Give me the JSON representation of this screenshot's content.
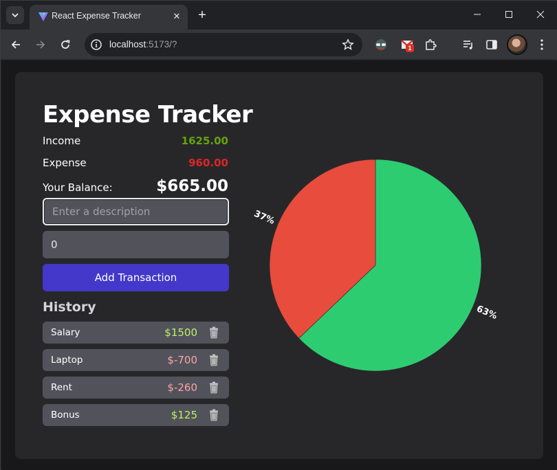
{
  "browser": {
    "tab_title": "React Expense Tracker",
    "url_host": "localhost",
    "url_rest": ":5173/?",
    "extension_badge": "1"
  },
  "app": {
    "title": "Expense Tracker",
    "income_label": "Income",
    "income_value": "1625.00",
    "expense_label": "Expense",
    "expense_value": "960.00",
    "balance_label": "Your Balance:",
    "balance_value": "$665.00",
    "description_placeholder": "Enter a description",
    "amount_value": "0",
    "add_button": "Add Transaction",
    "history_title": "History",
    "history": [
      {
        "desc": "Salary",
        "amount": "$1500",
        "type": "pos"
      },
      {
        "desc": "Laptop",
        "amount": "$-700",
        "type": "neg"
      },
      {
        "desc": "Rent",
        "amount": "$-260",
        "type": "neg"
      },
      {
        "desc": "Bonus",
        "amount": "$125",
        "type": "pos"
      }
    ],
    "colors": {
      "income": "#65a30d",
      "expense": "#dc2626",
      "button": "#4338ca",
      "pie_income": "#2ecc71",
      "pie_expense": "#e74c3c"
    }
  },
  "chart_data": {
    "type": "pie",
    "categories": [
      "Income",
      "Expense"
    ],
    "values": [
      1625,
      960
    ],
    "labels": [
      "63%",
      "37%"
    ],
    "colors": [
      "#2ecc71",
      "#e74c3c"
    ]
  }
}
